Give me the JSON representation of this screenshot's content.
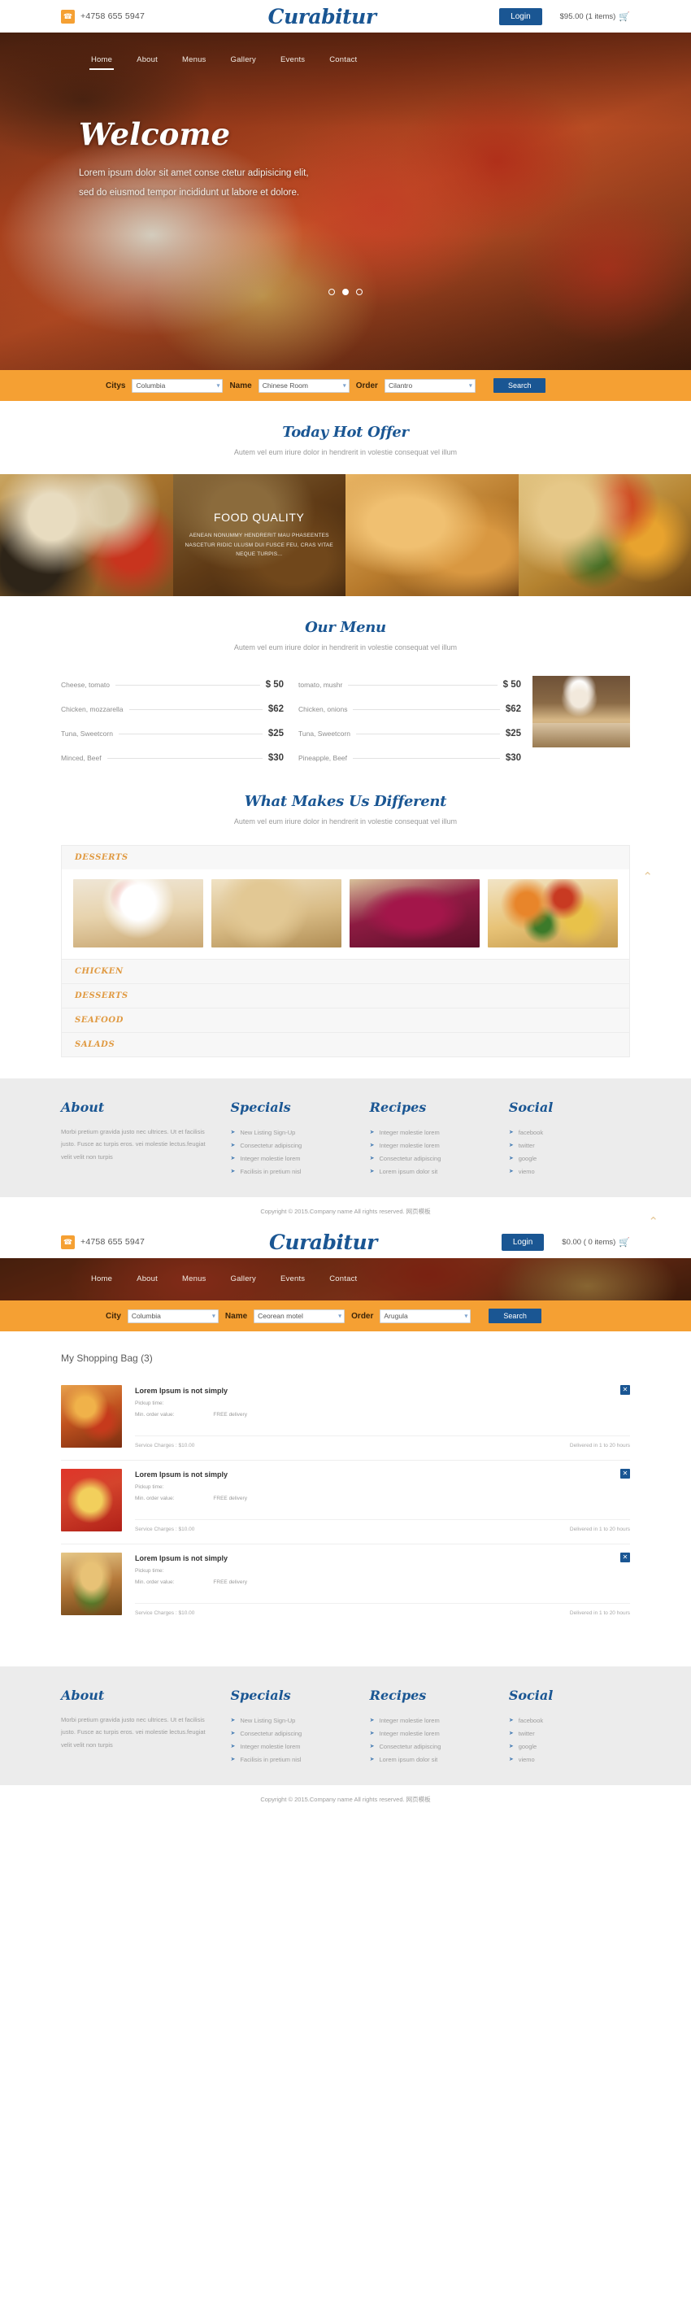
{
  "topbar": {
    "phone": "+4758 655 5947",
    "phone_icon": "phone-icon",
    "brand": "Curabitur",
    "login_label": "Login",
    "cart_text": "$95.00 (1 items)",
    "cart_icon": "shopping-cart-icon"
  },
  "topbar2": {
    "phone": "+4758 655 5947",
    "brand": "Curabitur",
    "login_label": "Login",
    "cart_text": "$0.00 ( 0 items)"
  },
  "nav": {
    "items": [
      {
        "label": "Home",
        "active": true
      },
      {
        "label": "About",
        "active": false
      },
      {
        "label": "Menus",
        "active": false
      },
      {
        "label": "Gallery",
        "active": false
      },
      {
        "label": "Events",
        "active": false
      },
      {
        "label": "Contact",
        "active": false
      }
    ]
  },
  "hero": {
    "title": "Welcome",
    "line1": "Lorem ipsum dolor sit amet conse ctetur adipisicing elit,",
    "line2": "sed do eiusmod tempor incididunt ut labore et dolore.",
    "dots": 3,
    "active_dot": 1
  },
  "search": {
    "city_label": "Citys",
    "city_value": "Columbia",
    "name_label": "Name",
    "name_value": "Chinese Room",
    "order_label": "Order",
    "order_value": "Cilantro",
    "button": "Search"
  },
  "search2": {
    "city_label": "City",
    "city_value": "Columbia",
    "name_label": "Name",
    "name_value": "Ceorean motel",
    "order_label": "Order",
    "order_value": "Arugula",
    "button": "Search"
  },
  "hot_offer": {
    "title": "Today Hot Offer",
    "subtitle": "Autem vel eum iriure dolor in hendrerit in volestie consequat vel illum",
    "overlay_title": "FOOD QUALITY",
    "overlay_body": "AENEAN NONUMMY HENDRERIT MAU PHASEENTES NASCETUR RIDIC ULUSM DUI FUSCE FEU, CRAS VITAE NEQUE TURPIS..."
  },
  "our_menu": {
    "title": "Our Menu",
    "subtitle": "Autem vel eum iriure dolor in hendrerit in volestie consequat vel illum",
    "left_items": [
      {
        "name": "Cheese, tomato",
        "price": "$ 50"
      },
      {
        "name": "Chicken, mozzarella",
        "price": "$62"
      },
      {
        "name": "Tuna, Sweetcorn",
        "price": "$25"
      },
      {
        "name": "Minced, Beef",
        "price": "$30"
      }
    ],
    "right_items": [
      {
        "name": "tomato, mushr",
        "price": "$ 50"
      },
      {
        "name": "Chicken, onions",
        "price": "$62"
      },
      {
        "name": "Tuna, Sweetcorn",
        "price": "$25"
      },
      {
        "name": "Pineapple, Beef",
        "price": "$30"
      }
    ],
    "chef_image_alt": "chef-photo"
  },
  "different": {
    "title": "What Makes Us Different",
    "subtitle": "Autem vel eum iriure dolor in hendrerit in volestie consequat vel illum",
    "open_tab": "DESSERTS",
    "closed_tabs": [
      "CHICKEN",
      "DESSERTS",
      "SEAFOOD",
      "SALADS"
    ],
    "cards": [
      "dessert-roll-cake",
      "walnut-tart",
      "berry-pie",
      "fruit-platter"
    ]
  },
  "footer": {
    "about": {
      "title": "About",
      "text": "Morbi pretium gravida justo nec ultrices. Ut et facilisis justo. Fusce ac turpis eros. vei molestie lectus.feugiat velit velit non turpis"
    },
    "specials": {
      "title": "Specials",
      "links": [
        "New Listing Sign-Up",
        "Consectetur adipiscing",
        "Integer molestie lorem",
        "Facilisis in pretium nisl"
      ]
    },
    "recipes": {
      "title": "Recipes",
      "links": [
        "Integer molestie lorem",
        "Integer molestie lorem",
        "Consectetur adipiscing",
        "Lorem ipsum dolor sit"
      ]
    },
    "social": {
      "title": "Social",
      "links": [
        "facebook",
        "twitter",
        "google",
        "viemo"
      ]
    },
    "copyright": "Copyright © 2015.Company name All rights reserved. 网页模板"
  },
  "bag": {
    "title": "My Shopping Bag (3)",
    "items": [
      {
        "thumb": "fried-chicken-thumb",
        "name": "Lorem Ipsum is not simply",
        "pickup_label": "Pickup time:",
        "min_order_label": "Min. order value:",
        "delivery_label": "FREE delivery",
        "service_charges": "Service Charges : $10.00",
        "delivered": "Delivered in 1 to 20 hours",
        "close_icon": "close-icon"
      },
      {
        "thumb": "fries-thumb",
        "name": "Lorem Ipsum is not simply",
        "pickup_label": "Pickup time:",
        "min_order_label": "Min. order value:",
        "delivery_label": "FREE delivery",
        "service_charges": "Service Charges : $10.00",
        "delivered": "Delivered in 1 to 20 hours",
        "close_icon": "close-icon"
      },
      {
        "thumb": "burger-thumb",
        "name": "Lorem Ipsum is not simply",
        "pickup_label": "Pickup time:",
        "min_order_label": "Min. order value:",
        "delivery_label": "FREE delivery",
        "service_charges": "Service Charges : $10.00",
        "delivered": "Delivered in 1 to 20 hours",
        "close_icon": "close-icon"
      }
    ]
  },
  "colors": {
    "brand_blue": "#1a5693",
    "accent_orange": "#f5a033",
    "tab_orange": "#e09a42",
    "footer_bg": "#ececec"
  }
}
